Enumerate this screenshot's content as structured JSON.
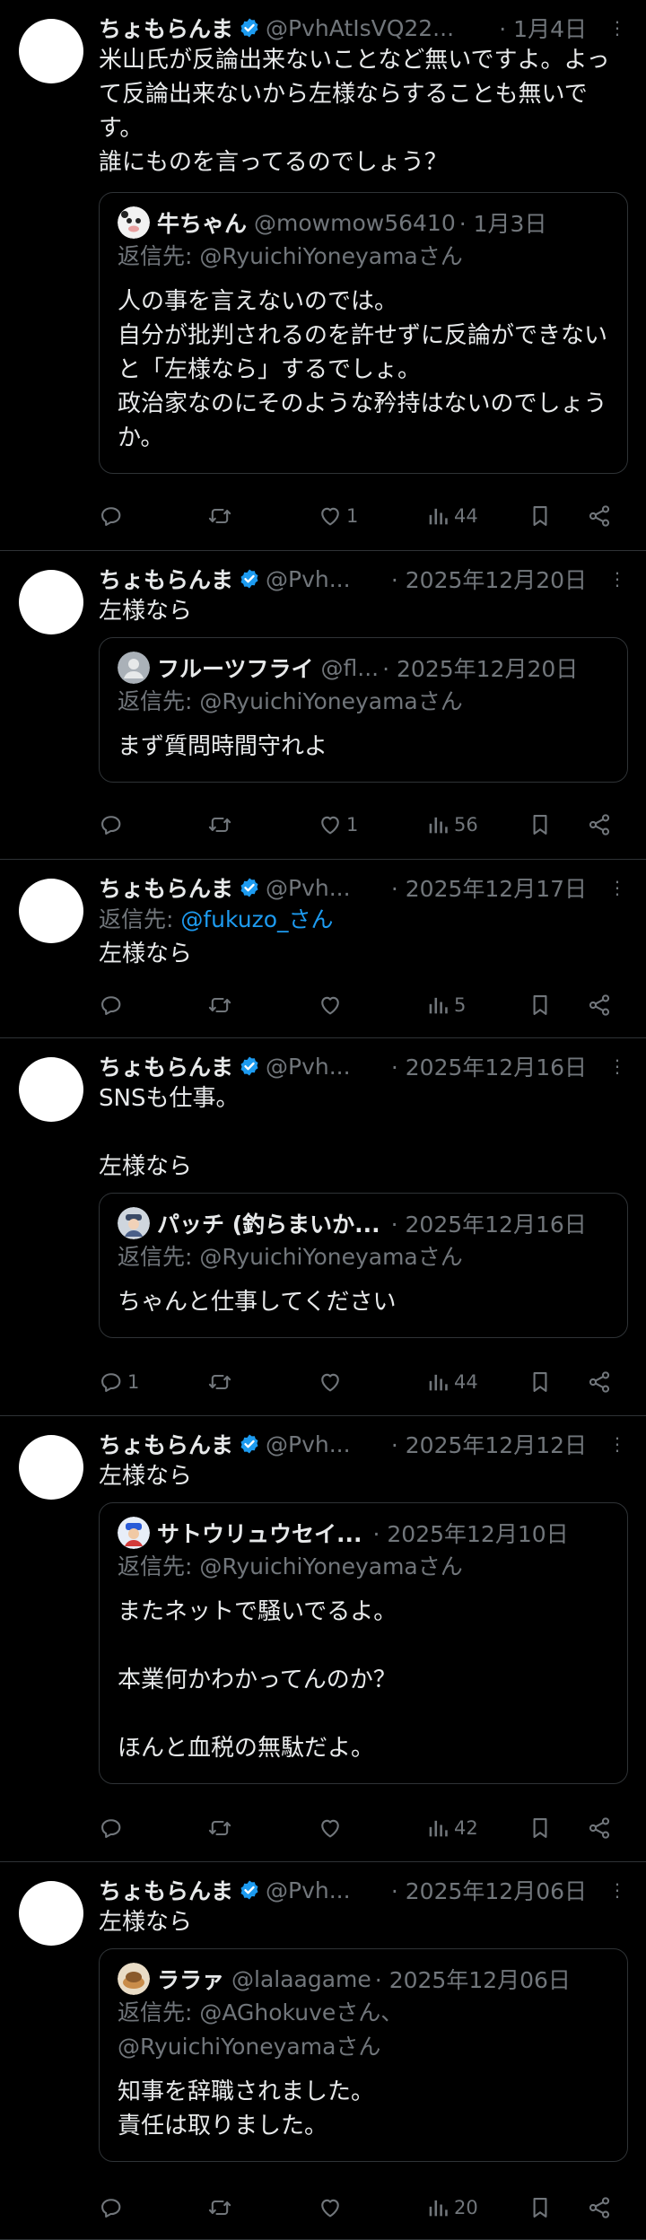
{
  "colors": {
    "background": "#000000",
    "text": "#e7e9ea",
    "muted": "#71767b",
    "link": "#1d9bf0",
    "border": "#2f3336"
  },
  "tweets": [
    {
      "name": "ちょもらんま",
      "handle": "@PvhAtIsVQ22...",
      "time": "· 1月4日",
      "text": "米山氏が反論出来ないことなど無いですよ。よって反論出来ないから左様ならすることも無いです。\n誰にものを言ってるのでしょう？",
      "quote": {
        "name": "牛ちゃん",
        "handle": "@mowmow56410",
        "time": "· 1月3日",
        "reply_to": "返信先: @RyuichiYoneyamaさん",
        "text": "人の事を言えないのでは。\n自分が批判されるのを許せずに反論ができないと「左様なら」するでしょ。\n政治家なのにそのような矜持はないのでしょうか。"
      },
      "stats": {
        "replies": "",
        "retweets": "",
        "likes": "1",
        "views": "44"
      }
    },
    {
      "name": "ちょもらんま",
      "handle": "@Pvh...",
      "time": "· 2025年12月20日",
      "text": "左様なら",
      "quote": {
        "name": "フルーツフライ",
        "handle": "@fl...",
        "time": "· 2025年12月20日",
        "reply_to": "返信先: @RyuichiYoneyamaさん",
        "text": "まず質問時間守れよ"
      },
      "stats": {
        "replies": "",
        "retweets": "",
        "likes": "1",
        "views": "56"
      }
    },
    {
      "name": "ちょもらんま",
      "handle": "@Pvh...",
      "time": "· 2025年12月17日",
      "reply_prefix": "返信先: ",
      "reply_link": "@fukuzo_さん",
      "text": "左様なら",
      "stats": {
        "replies": "",
        "retweets": "",
        "likes": "",
        "views": "5"
      }
    },
    {
      "name": "ちょもらんま",
      "handle": "@Pvh...",
      "time": "· 2025年12月16日",
      "text": "SNSも仕事。\n\n左様なら",
      "quote": {
        "name": "パッチ (釣らまいか...",
        "handle": "",
        "time": "· 2025年12月16日",
        "reply_to": "返信先: @RyuichiYoneyamaさん",
        "text": "ちゃんと仕事してください"
      },
      "stats": {
        "replies": "1",
        "retweets": "",
        "likes": "",
        "views": "44"
      }
    },
    {
      "name": "ちょもらんま",
      "handle": "@Pvh...",
      "time": "· 2025年12月12日",
      "text": "左様なら",
      "quote": {
        "name": "サトウリュウセイ...",
        "handle": "",
        "time": "· 2025年12月10日",
        "reply_to": "返信先: @RyuichiYoneyamaさん",
        "text": "またネットで騒いでるよ。\n\n本業何かわかってんのか？\n\nほんと血税の無駄だよ。"
      },
      "stats": {
        "replies": "",
        "retweets": "",
        "likes": "",
        "views": "42"
      }
    },
    {
      "name": "ちょもらんま",
      "handle": "@Pvh...",
      "time": "· 2025年12月06日",
      "text": "左様なら",
      "quote": {
        "name": "ララァ",
        "handle": "@lalaagame",
        "time": "· 2025年12月06日",
        "reply_to": "返信先: @AGhokuveさん、\n@RyuichiYoneyamaさん",
        "text": "知事を辞職されました。\n責任は取りました。"
      },
      "stats": {
        "replies": "",
        "retweets": "",
        "likes": "",
        "views": "20"
      }
    }
  ]
}
